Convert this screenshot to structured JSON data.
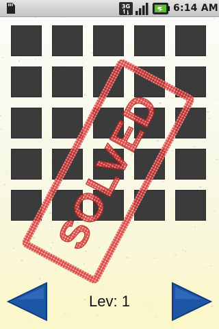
{
  "status_bar": {
    "time": "6:14 AM",
    "network_type": "3G",
    "icons": [
      "sd-card-icon",
      "network-3g-icon",
      "signal-strength-icon",
      "battery-icon"
    ]
  },
  "board": {
    "rows": 5,
    "cols": 5,
    "cell_color": "#3b3b3b",
    "state": "solved"
  },
  "stamp": {
    "text": "SOLVED",
    "color": "#d23a3a"
  },
  "navigation": {
    "level_text": "Lev: 1",
    "prev_icon": "left-arrow-icon",
    "next_icon": "right-arrow-icon",
    "arrow_color": "#1e56a6"
  }
}
